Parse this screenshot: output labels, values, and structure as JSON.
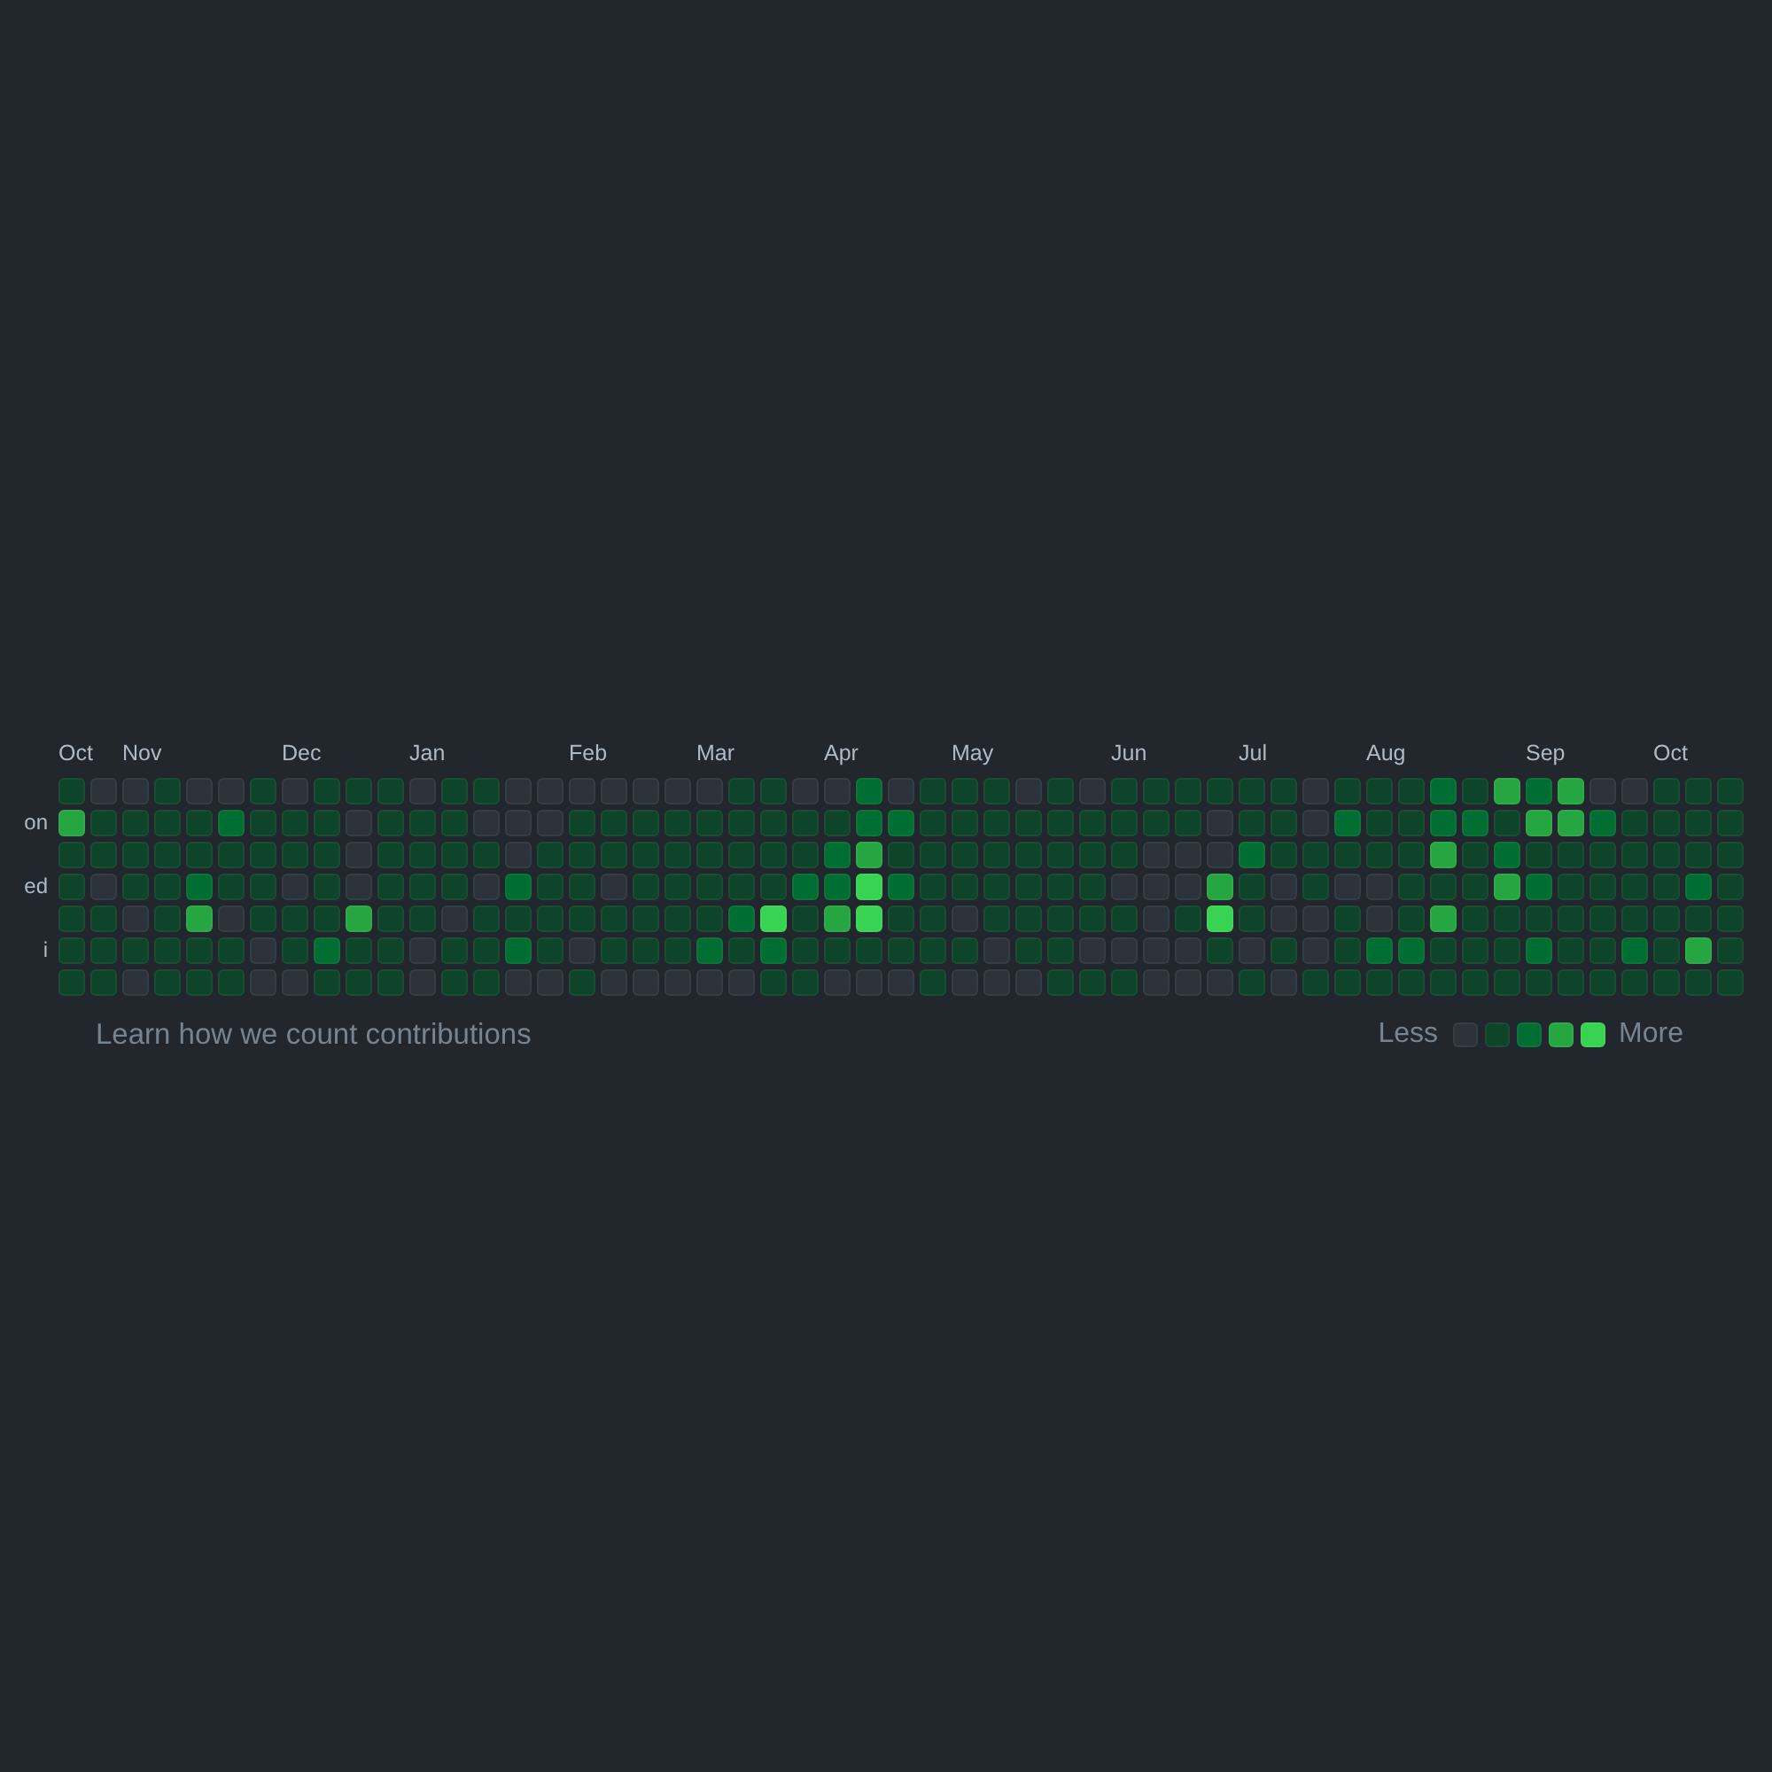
{
  "day_labels": [
    "on",
    "ed",
    "i"
  ],
  "weeks": [
    {
      "month": "Oct",
      "days": [
        {
          "color": "#0e4429"
        },
        {
          "color": "#26a641"
        },
        {
          "color": "#0e4429"
        },
        {
          "color": "#0e4429"
        },
        {
          "color": "#0e4429"
        },
        {
          "color": "#0e4429"
        },
        {
          "color": "#0e4429"
        }
      ]
    },
    {
      "days": [
        {
          "color": "#2d333b"
        },
        {
          "color": "#0e4429"
        },
        {
          "color": "#0e4429"
        },
        {
          "color": "#2d333b"
        },
        {
          "color": "#0e4429"
        },
        {
          "color": "#0e4429"
        },
        {
          "color": "#0e4429"
        }
      ]
    },
    {
      "month": "Nov",
      "days": [
        {
          "color": "#2d333b"
        },
        {
          "color": "#0e4429"
        },
        {
          "color": "#0e4429"
        },
        {
          "color": "#0e4429"
        },
        {
          "color": "#2d333b"
        },
        {
          "color": "#0e4429"
        },
        {
          "color": "#2d333b"
        }
      ]
    },
    {
      "days": [
        {
          "color": "#0e4429"
        },
        {
          "color": "#0e4429"
        },
        {
          "color": "#0e4429"
        },
        {
          "color": "#0e4429"
        },
        {
          "color": "#0e4429"
        },
        {
          "color": "#0e4429"
        },
        {
          "color": "#0e4429"
        }
      ]
    },
    {
      "days": [
        {
          "color": "#2d333b"
        },
        {
          "color": "#0e4429"
        },
        {
          "color": "#0e4429"
        },
        {
          "color": "#006d32"
        },
        {
          "color": "#26a641"
        },
        {
          "color": "#0e4429"
        },
        {
          "color": "#0e4429"
        }
      ]
    },
    {
      "days": [
        {
          "color": "#2d333b"
        },
        {
          "color": "#006d32"
        },
        {
          "color": "#0e4429"
        },
        {
          "color": "#0e4429"
        },
        {
          "color": "#2d333b"
        },
        {
          "color": "#0e4429"
        },
        {
          "color": "#0e4429"
        }
      ]
    },
    {
      "days": [
        {
          "color": "#0e4429"
        },
        {
          "color": "#0e4429"
        },
        {
          "color": "#0e4429"
        },
        {
          "color": "#0e4429"
        },
        {
          "color": "#0e4429"
        },
        {
          "color": "#2d333b"
        },
        {
          "color": "#2d333b"
        }
      ]
    },
    {
      "month": "Dec",
      "days": [
        {
          "color": "#2d333b"
        },
        {
          "color": "#0e4429"
        },
        {
          "color": "#0e4429"
        },
        {
          "color": "#2d333b"
        },
        {
          "color": "#0e4429"
        },
        {
          "color": "#0e4429"
        },
        {
          "color": "#2d333b"
        }
      ]
    },
    {
      "days": [
        {
          "color": "#0e4429"
        },
        {
          "color": "#0e4429"
        },
        {
          "color": "#0e4429"
        },
        {
          "color": "#0e4429"
        },
        {
          "color": "#0e4429"
        },
        {
          "color": "#006d32"
        },
        {
          "color": "#0e4429"
        }
      ]
    },
    {
      "days": [
        {
          "color": "#0e4429"
        },
        {
          "color": "#2d333b"
        },
        {
          "color": "#2d333b"
        },
        {
          "color": "#2d333b"
        },
        {
          "color": "#26a641"
        },
        {
          "color": "#0e4429"
        },
        {
          "color": "#0e4429"
        }
      ]
    },
    {
      "days": [
        {
          "color": "#0e4429"
        },
        {
          "color": "#0e4429"
        },
        {
          "color": "#0e4429"
        },
        {
          "color": "#0e4429"
        },
        {
          "color": "#0e4429"
        },
        {
          "color": "#0e4429"
        },
        {
          "color": "#0e4429"
        }
      ]
    },
    {
      "month": "Jan",
      "days": [
        {
          "color": "#2d333b"
        },
        {
          "color": "#0e4429"
        },
        {
          "color": "#0e4429"
        },
        {
          "color": "#0e4429"
        },
        {
          "color": "#0e4429"
        },
        {
          "color": "#2d333b"
        },
        {
          "color": "#2d333b"
        }
      ]
    },
    {
      "days": [
        {
          "color": "#0e4429"
        },
        {
          "color": "#0e4429"
        },
        {
          "color": "#0e4429"
        },
        {
          "color": "#0e4429"
        },
        {
          "color": "#2d333b"
        },
        {
          "color": "#0e4429"
        },
        {
          "color": "#0e4429"
        }
      ]
    },
    {
      "days": [
        {
          "color": "#0e4429"
        },
        {
          "color": "#2d333b"
        },
        {
          "color": "#0e4429"
        },
        {
          "color": "#2d333b"
        },
        {
          "color": "#0e4429"
        },
        {
          "color": "#0e4429"
        },
        {
          "color": "#0e4429"
        }
      ]
    },
    {
      "days": [
        {
          "color": "#2d333b"
        },
        {
          "color": "#2d333b"
        },
        {
          "color": "#2d333b"
        },
        {
          "color": "#006d32"
        },
        {
          "color": "#0e4429"
        },
        {
          "color": "#006d32"
        },
        {
          "color": "#2d333b"
        }
      ]
    },
    {
      "days": [
        {
          "color": "#2d333b"
        },
        {
          "color": "#2d333b"
        },
        {
          "color": "#0e4429"
        },
        {
          "color": "#0e4429"
        },
        {
          "color": "#0e4429"
        },
        {
          "color": "#0e4429"
        },
        {
          "color": "#2d333b"
        }
      ]
    },
    {
      "month": "Feb",
      "days": [
        {
          "color": "#2d333b"
        },
        {
          "color": "#0e4429"
        },
        {
          "color": "#0e4429"
        },
        {
          "color": "#0e4429"
        },
        {
          "color": "#0e4429"
        },
        {
          "color": "#2d333b"
        },
        {
          "color": "#0e4429"
        }
      ]
    },
    {
      "days": [
        {
          "color": "#2d333b"
        },
        {
          "color": "#0e4429"
        },
        {
          "color": "#0e4429"
        },
        {
          "color": "#2d333b"
        },
        {
          "color": "#0e4429"
        },
        {
          "color": "#0e4429"
        },
        {
          "color": "#2d333b"
        }
      ]
    },
    {
      "days": [
        {
          "color": "#2d333b"
        },
        {
          "color": "#0e4429"
        },
        {
          "color": "#0e4429"
        },
        {
          "color": "#0e4429"
        },
        {
          "color": "#0e4429"
        },
        {
          "color": "#0e4429"
        },
        {
          "color": "#2d333b"
        }
      ]
    },
    {
      "days": [
        {
          "color": "#2d333b"
        },
        {
          "color": "#0e4429"
        },
        {
          "color": "#0e4429"
        },
        {
          "color": "#0e4429"
        },
        {
          "color": "#0e4429"
        },
        {
          "color": "#0e4429"
        },
        {
          "color": "#2d333b"
        }
      ]
    },
    {
      "month": "Mar",
      "days": [
        {
          "color": "#2d333b"
        },
        {
          "color": "#0e4429"
        },
        {
          "color": "#0e4429"
        },
        {
          "color": "#0e4429"
        },
        {
          "color": "#0e4429"
        },
        {
          "color": "#006d32"
        },
        {
          "color": "#2d333b"
        }
      ]
    },
    {
      "days": [
        {
          "color": "#0e4429"
        },
        {
          "color": "#0e4429"
        },
        {
          "color": "#0e4429"
        },
        {
          "color": "#0e4429"
        },
        {
          "color": "#006d32"
        },
        {
          "color": "#0e4429"
        },
        {
          "color": "#2d333b"
        }
      ]
    },
    {
      "days": [
        {
          "color": "#0e4429"
        },
        {
          "color": "#0e4429"
        },
        {
          "color": "#0e4429"
        },
        {
          "color": "#0e4429"
        },
        {
          "color": "#39d353"
        },
        {
          "color": "#006d32"
        },
        {
          "color": "#0e4429"
        }
      ]
    },
    {
      "days": [
        {
          "color": "#2d333b"
        },
        {
          "color": "#0e4429"
        },
        {
          "color": "#0e4429"
        },
        {
          "color": "#006d32"
        },
        {
          "color": "#0e4429"
        },
        {
          "color": "#0e4429"
        },
        {
          "color": "#0e4429"
        }
      ]
    },
    {
      "month": "Apr",
      "days": [
        {
          "color": "#2d333b"
        },
        {
          "color": "#0e4429"
        },
        {
          "color": "#006d32"
        },
        {
          "color": "#006d32"
        },
        {
          "color": "#26a641"
        },
        {
          "color": "#0e4429"
        },
        {
          "color": "#2d333b"
        }
      ]
    },
    {
      "days": [
        {
          "color": "#006d32"
        },
        {
          "color": "#006d32"
        },
        {
          "color": "#26a641"
        },
        {
          "color": "#39d353"
        },
        {
          "color": "#39d353"
        },
        {
          "color": "#0e4429"
        },
        {
          "color": "#2d333b"
        }
      ]
    },
    {
      "days": [
        {
          "color": "#2d333b"
        },
        {
          "color": "#006d32"
        },
        {
          "color": "#0e4429"
        },
        {
          "color": "#006d32"
        },
        {
          "color": "#0e4429"
        },
        {
          "color": "#0e4429"
        },
        {
          "color": "#2d333b"
        }
      ]
    },
    {
      "days": [
        {
          "color": "#0e4429"
        },
        {
          "color": "#0e4429"
        },
        {
          "color": "#0e4429"
        },
        {
          "color": "#0e4429"
        },
        {
          "color": "#0e4429"
        },
        {
          "color": "#0e4429"
        },
        {
          "color": "#0e4429"
        }
      ]
    },
    {
      "month": "May",
      "days": [
        {
          "color": "#0e4429"
        },
        {
          "color": "#0e4429"
        },
        {
          "color": "#0e4429"
        },
        {
          "color": "#0e4429"
        },
        {
          "color": "#2d333b"
        },
        {
          "color": "#0e4429"
        },
        {
          "color": "#2d333b"
        }
      ]
    },
    {
      "days": [
        {
          "color": "#0e4429"
        },
        {
          "color": "#0e4429"
        },
        {
          "color": "#0e4429"
        },
        {
          "color": "#0e4429"
        },
        {
          "color": "#0e4429"
        },
        {
          "color": "#2d333b"
        },
        {
          "color": "#2d333b"
        }
      ]
    },
    {
      "days": [
        {
          "color": "#2d333b"
        },
        {
          "color": "#0e4429"
        },
        {
          "color": "#0e4429"
        },
        {
          "color": "#0e4429"
        },
        {
          "color": "#0e4429"
        },
        {
          "color": "#0e4429"
        },
        {
          "color": "#2d333b"
        }
      ]
    },
    {
      "days": [
        {
          "color": "#0e4429"
        },
        {
          "color": "#0e4429"
        },
        {
          "color": "#0e4429"
        },
        {
          "color": "#0e4429"
        },
        {
          "color": "#0e4429"
        },
        {
          "color": "#0e4429"
        },
        {
          "color": "#0e4429"
        }
      ]
    },
    {
      "days": [
        {
          "color": "#2d333b"
        },
        {
          "color": "#0e4429"
        },
        {
          "color": "#0e4429"
        },
        {
          "color": "#0e4429"
        },
        {
          "color": "#0e4429"
        },
        {
          "color": "#2d333b"
        },
        {
          "color": "#0e4429"
        }
      ]
    },
    {
      "month": "Jun",
      "days": [
        {
          "color": "#0e4429"
        },
        {
          "color": "#0e4429"
        },
        {
          "color": "#0e4429"
        },
        {
          "color": "#2d333b"
        },
        {
          "color": "#0e4429"
        },
        {
          "color": "#2d333b"
        },
        {
          "color": "#0e4429"
        }
      ]
    },
    {
      "days": [
        {
          "color": "#0e4429"
        },
        {
          "color": "#0e4429"
        },
        {
          "color": "#2d333b"
        },
        {
          "color": "#2d333b"
        },
        {
          "color": "#2d333b"
        },
        {
          "color": "#2d333b"
        },
        {
          "color": "#2d333b"
        }
      ]
    },
    {
      "days": [
        {
          "color": "#0e4429"
        },
        {
          "color": "#0e4429"
        },
        {
          "color": "#2d333b"
        },
        {
          "color": "#2d333b"
        },
        {
          "color": "#0e4429"
        },
        {
          "color": "#2d333b"
        },
        {
          "color": "#2d333b"
        }
      ]
    },
    {
      "days": [
        {
          "color": "#0e4429"
        },
        {
          "color": "#2d333b"
        },
        {
          "color": "#2d333b"
        },
        {
          "color": "#26a641"
        },
        {
          "color": "#39d353"
        },
        {
          "color": "#0e4429"
        },
        {
          "color": "#2d333b"
        }
      ]
    },
    {
      "month": "Jul",
      "days": [
        {
          "color": "#0e4429"
        },
        {
          "color": "#0e4429"
        },
        {
          "color": "#006d32"
        },
        {
          "color": "#0e4429"
        },
        {
          "color": "#0e4429"
        },
        {
          "color": "#2d333b"
        },
        {
          "color": "#0e4429"
        }
      ]
    },
    {
      "days": [
        {
          "color": "#0e4429"
        },
        {
          "color": "#0e4429"
        },
        {
          "color": "#0e4429"
        },
        {
          "color": "#2d333b"
        },
        {
          "color": "#2d333b"
        },
        {
          "color": "#0e4429"
        },
        {
          "color": "#2d333b"
        }
      ]
    },
    {
      "days": [
        {
          "color": "#2d333b"
        },
        {
          "color": "#2d333b"
        },
        {
          "color": "#0e4429"
        },
        {
          "color": "#0e4429"
        },
        {
          "color": "#2d333b"
        },
        {
          "color": "#2d333b"
        },
        {
          "color": "#0e4429"
        }
      ]
    },
    {
      "days": [
        {
          "color": "#0e4429"
        },
        {
          "color": "#006d32"
        },
        {
          "color": "#0e4429"
        },
        {
          "color": "#2d333b"
        },
        {
          "color": "#0e4429"
        },
        {
          "color": "#0e4429"
        },
        {
          "color": "#0e4429"
        }
      ]
    },
    {
      "month": "Aug",
      "days": [
        {
          "color": "#0e4429"
        },
        {
          "color": "#0e4429"
        },
        {
          "color": "#0e4429"
        },
        {
          "color": "#2d333b"
        },
        {
          "color": "#2d333b"
        },
        {
          "color": "#006d32"
        },
        {
          "color": "#0e4429"
        }
      ]
    },
    {
      "days": [
        {
          "color": "#0e4429"
        },
        {
          "color": "#0e4429"
        },
        {
          "color": "#0e4429"
        },
        {
          "color": "#0e4429"
        },
        {
          "color": "#0e4429"
        },
        {
          "color": "#006d32"
        },
        {
          "color": "#0e4429"
        }
      ]
    },
    {
      "days": [
        {
          "color": "#006d32"
        },
        {
          "color": "#006d32"
        },
        {
          "color": "#26a641"
        },
        {
          "color": "#0e4429"
        },
        {
          "color": "#26a641"
        },
        {
          "color": "#0e4429"
        },
        {
          "color": "#0e4429"
        }
      ]
    },
    {
      "days": [
        {
          "color": "#0e4429"
        },
        {
          "color": "#006d32"
        },
        {
          "color": "#0e4429"
        },
        {
          "color": "#0e4429"
        },
        {
          "color": "#0e4429"
        },
        {
          "color": "#0e4429"
        },
        {
          "color": "#0e4429"
        }
      ]
    },
    {
      "days": [
        {
          "color": "#26a641"
        },
        {
          "color": "#0e4429"
        },
        {
          "color": "#006d32"
        },
        {
          "color": "#26a641"
        },
        {
          "color": "#0e4429"
        },
        {
          "color": "#0e4429"
        },
        {
          "color": "#0e4429"
        }
      ]
    },
    {
      "month": "Sep",
      "days": [
        {
          "color": "#006d32"
        },
        {
          "color": "#26a641"
        },
        {
          "color": "#0e4429"
        },
        {
          "color": "#006d32"
        },
        {
          "color": "#0e4429"
        },
        {
          "color": "#006d32"
        },
        {
          "color": "#0e4429"
        }
      ]
    },
    {
      "days": [
        {
          "color": "#26a641"
        },
        {
          "color": "#26a641"
        },
        {
          "color": "#0e4429"
        },
        {
          "color": "#0e4429"
        },
        {
          "color": "#0e4429"
        },
        {
          "color": "#0e4429"
        },
        {
          "color": "#0e4429"
        }
      ]
    },
    {
      "days": [
        {
          "color": "#2d333b"
        },
        {
          "color": "#006d32"
        },
        {
          "color": "#0e4429"
        },
        {
          "color": "#0e4429"
        },
        {
          "color": "#0e4429"
        },
        {
          "color": "#0e4429"
        },
        {
          "color": "#0e4429"
        }
      ]
    },
    {
      "days": [
        {
          "color": "#2d333b"
        },
        {
          "color": "#0e4429"
        },
        {
          "color": "#0e4429"
        },
        {
          "color": "#0e4429"
        },
        {
          "color": "#0e4429"
        },
        {
          "color": "#006d32"
        },
        {
          "color": "#0e4429"
        }
      ]
    },
    {
      "month": "Oct",
      "days": [
        {
          "color": "#0e4429"
        },
        {
          "color": "#0e4429"
        },
        {
          "color": "#0e4429"
        },
        {
          "color": "#0e4429"
        },
        {
          "color": "#0e4429"
        },
        {
          "color": "#0e4429"
        },
        {
          "color": "#0e4429"
        }
      ]
    },
    {
      "days": [
        {
          "color": "#0e4429"
        },
        {
          "color": "#0e4429"
        },
        {
          "color": "#0e4429"
        },
        {
          "color": "#006d32"
        },
        {
          "color": "#0e4429"
        },
        {
          "color": "#26a641"
        },
        {
          "color": "#0e4429"
        }
      ]
    },
    {
      "days": [
        {
          "color": "#0e4429"
        },
        {
          "color": "#0e4429"
        },
        {
          "color": "#0e4429"
        },
        {
          "color": "#0e4429"
        },
        {
          "color": "#0e4429"
        },
        {
          "color": "#0e4429"
        },
        {
          "color": "#0e4429"
        }
      ]
    }
  ],
  "footer": {
    "link": "Learn how we count contributions",
    "legend": {
      "less": "Less",
      "more": "More",
      "swatches": [
        {
          "color": "#2d333b"
        },
        {
          "color": "#0e4429"
        },
        {
          "color": "#006d32"
        },
        {
          "color": "#26a641"
        },
        {
          "color": "#39d353"
        }
      ]
    }
  }
}
